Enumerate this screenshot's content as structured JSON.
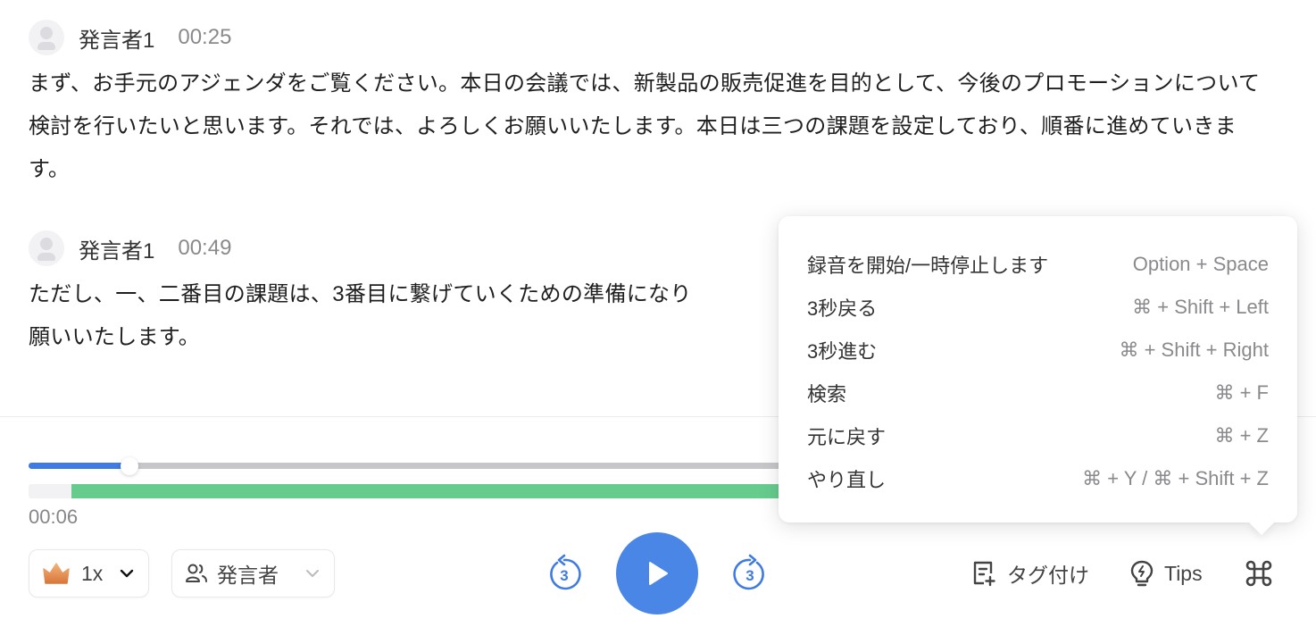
{
  "transcript": {
    "segments": [
      {
        "speaker": "発言者1",
        "timestamp": "00:25",
        "text": "まず、お手元のアジェンダをご覧ください。本日の会議では、新製品の販売促進を目的として、今後のプロモーションについて検討を行いたいと思います。それでは、よろしくお願いいたします。本日は三つの課題を設定しており、順番に進めていきます。"
      },
      {
        "speaker": "発言者1",
        "timestamp": "00:49",
        "text": "ただし、一、二番目の課題は、3番目に繋げていくための準備になり",
        "text_line2": "願いいたします。"
      }
    ]
  },
  "player": {
    "current_time": "00:06",
    "progress_fraction": 0.08,
    "speech_regions": [
      {
        "start": 0.034,
        "end": 1.0
      }
    ],
    "speed": "1x",
    "speaker_filter": "発言者",
    "skip_back_seconds": "3",
    "skip_forward_seconds": "3",
    "tag_label": "タグ付け",
    "tips_label": "Tips"
  },
  "colors": {
    "accent": "#4a86e6",
    "progress": "#3f7be0",
    "speech": "#66cc8e",
    "crown": "#e08a4a"
  },
  "shortcuts": [
    {
      "action": "録音を開始/一時停止します",
      "keys": "Option + Space"
    },
    {
      "action": "3秒戻る",
      "keys": "⌘ + Shift + Left"
    },
    {
      "action": "3秒進む",
      "keys": "⌘ + Shift + Right"
    },
    {
      "action": "検索",
      "keys": "⌘ + F"
    },
    {
      "action": "元に戻す",
      "keys": "⌘ + Z"
    },
    {
      "action": "やり直し",
      "keys": "⌘ + Y / ⌘ + Shift + Z"
    }
  ]
}
